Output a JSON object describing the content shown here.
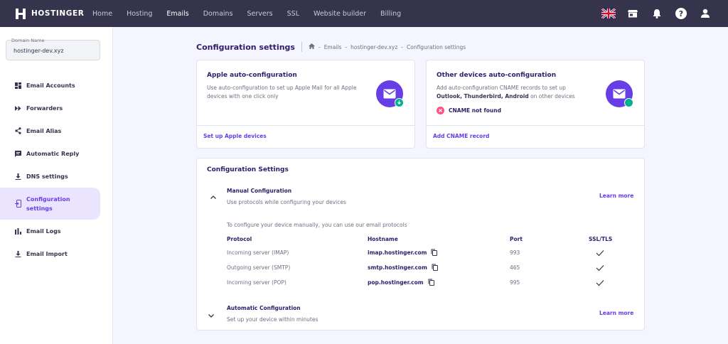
{
  "brand": {
    "name": "HOSTINGER"
  },
  "nav": {
    "items": [
      {
        "label": "Home"
      },
      {
        "label": "Hosting"
      },
      {
        "label": "Emails"
      },
      {
        "label": "Domains"
      },
      {
        "label": "Servers"
      },
      {
        "label": "SSL"
      },
      {
        "label": "Website builder"
      },
      {
        "label": "Billing"
      }
    ],
    "active": "Emails",
    "icons": [
      "uk-flag-icon",
      "store-icon",
      "bell-icon",
      "help-icon",
      "user-icon"
    ]
  },
  "sidebar": {
    "domain_label": "Domain Name",
    "domain_value": "hostinger-dev.xyz",
    "items": [
      {
        "label": "Email Accounts",
        "icon": "grid-icon"
      },
      {
        "label": "Forwarders",
        "icon": "forward-icon"
      },
      {
        "label": "Email Alias",
        "icon": "share-icon"
      },
      {
        "label": "Automatic Reply",
        "icon": "reply-icon"
      },
      {
        "label": "DNS settings",
        "icon": "download-icon"
      },
      {
        "label": "Configuration settings",
        "icon": "config-icon"
      },
      {
        "label": "Email Logs",
        "icon": "bar-chart-icon"
      },
      {
        "label": "Email Import",
        "icon": "import-icon"
      }
    ],
    "active": "Configuration settings"
  },
  "page": {
    "title": "Configuration settings",
    "breadcrumb": [
      "Emails",
      "hostinger-dev.xyz",
      "Configuration settings"
    ],
    "breadcrumb_sep": "-"
  },
  "apple_card": {
    "title": "Apple auto-configuration",
    "desc": "Use auto-configuration to set up Apple Mail for all Apple devices with one click only",
    "link": "Set up Apple devices"
  },
  "other_card": {
    "title": "Other devices auto-configuration",
    "desc_pre": "Add auto-configuration CNAME records to set up",
    "desc_bold": "Outlook, Thunderbird, Android",
    "desc_post": "on other devices",
    "status": "CNAME not found",
    "link": "Add CNAME record"
  },
  "config": {
    "title": "Configuration Settings",
    "manual": {
      "title": "Manual Configuration",
      "desc": "Use protocols while configuring your devices",
      "learn_more": "Learn more",
      "intro": "To configure your device manually, you can use our email protocols",
      "columns": [
        "Protocol",
        "Hostname",
        "Port",
        "SSL/TLS"
      ],
      "rows": [
        {
          "protocol": "Incoming server (IMAP)",
          "hostname": "imap.hostinger.com",
          "port": "993",
          "ssl": true
        },
        {
          "protocol": "Outgoing server (SMTP)",
          "hostname": "smtp.hostinger.com",
          "port": "465",
          "ssl": true
        },
        {
          "protocol": "Incoming server (POP)",
          "hostname": "pop.hostinger.com",
          "port": "995",
          "ssl": true
        }
      ]
    },
    "automatic": {
      "title": "Automatic Configuration",
      "desc": "Set up your device within minutes",
      "learn_more": "Learn more"
    }
  },
  "colors": {
    "accent": "#673de6",
    "nav_bg": "#36344d",
    "success": "#00b090",
    "error": "#fc5185"
  }
}
